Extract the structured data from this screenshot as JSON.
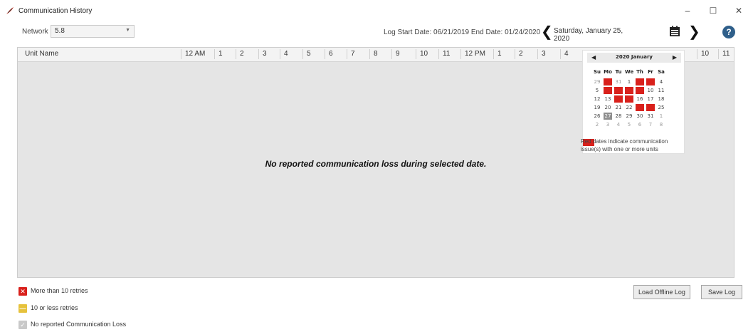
{
  "window": {
    "title": "Communication History",
    "minimize_glyph": "–",
    "maximize_glyph": "☐",
    "close_glyph": "✕",
    "icon": "app-feather-icon"
  },
  "toolbar": {
    "network_label": "Network",
    "network_value": "5.8",
    "log_range_text": "Log Start Date: 06/21/2019  End Date: 01/24/2020",
    "prev_glyph": "❮",
    "next_glyph": "❯",
    "selected_date": "Saturday, January 25, 2020",
    "help_glyph": "?"
  },
  "grid": {
    "unit_column": "Unit Name",
    "hours": [
      "12 AM",
      "1",
      "2",
      "3",
      "4",
      "5",
      "6",
      "7",
      "8",
      "9",
      "10",
      "11",
      "12 PM",
      "1",
      "2",
      "3",
      "4",
      "",
      "",
      "",
      "",
      "",
      "10",
      "11"
    ],
    "empty_message": "No reported communication loss during selected date."
  },
  "calendar": {
    "month_title": "2020 January",
    "prev_glyph": "◀",
    "next_glyph": "▶",
    "weekdays": [
      "Su",
      "Mo",
      "Tu",
      "We",
      "Th",
      "Fr",
      "Sa"
    ],
    "weeks": [
      [
        {
          "d": "29",
          "t": "other"
        },
        {
          "d": "30",
          "t": "red"
        },
        {
          "d": "31",
          "t": "other"
        },
        {
          "d": "1",
          "t": ""
        },
        {
          "d": "2",
          "t": "red"
        },
        {
          "d": "3",
          "t": "red"
        },
        {
          "d": "4",
          "t": ""
        }
      ],
      [
        {
          "d": "5",
          "t": ""
        },
        {
          "d": "6",
          "t": "red"
        },
        {
          "d": "7",
          "t": "red"
        },
        {
          "d": "8",
          "t": "red"
        },
        {
          "d": "9",
          "t": "red"
        },
        {
          "d": "10",
          "t": ""
        },
        {
          "d": "11",
          "t": ""
        }
      ],
      [
        {
          "d": "12",
          "t": ""
        },
        {
          "d": "13",
          "t": ""
        },
        {
          "d": "14",
          "t": "red"
        },
        {
          "d": "15",
          "t": "red"
        },
        {
          "d": "16",
          "t": ""
        },
        {
          "d": "17",
          "t": ""
        },
        {
          "d": "18",
          "t": ""
        }
      ],
      [
        {
          "d": "19",
          "t": ""
        },
        {
          "d": "20",
          "t": ""
        },
        {
          "d": "21",
          "t": ""
        },
        {
          "d": "22",
          "t": ""
        },
        {
          "d": "23",
          "t": "red"
        },
        {
          "d": "24",
          "t": "red"
        },
        {
          "d": "25",
          "t": ""
        }
      ],
      [
        {
          "d": "26",
          "t": ""
        },
        {
          "d": "27",
          "t": "sel"
        },
        {
          "d": "28",
          "t": ""
        },
        {
          "d": "29",
          "t": ""
        },
        {
          "d": "30",
          "t": ""
        },
        {
          "d": "31",
          "t": ""
        },
        {
          "d": "1",
          "t": "other"
        }
      ],
      [
        {
          "d": "2",
          "t": "other"
        },
        {
          "d": "3",
          "t": "other"
        },
        {
          "d": "4",
          "t": "other"
        },
        {
          "d": "5",
          "t": "other"
        },
        {
          "d": "6",
          "t": "other"
        },
        {
          "d": "7",
          "t": "other"
        },
        {
          "d": "8",
          "t": "other"
        }
      ]
    ],
    "legend_text": "Red dates indicate communication issue(s) with one or more units"
  },
  "legend": [
    {
      "text": "More than 10 retries",
      "color": "#d9211c",
      "glyph": "✕",
      "icon": "red-x-icon"
    },
    {
      "text": "10 or less retries",
      "color": "#e6c23c",
      "glyph": "—",
      "icon": "yellow-dash-icon"
    },
    {
      "text": "No reported Communication Loss",
      "color": "#c9c9c9",
      "glyph": "✓",
      "icon": "gray-check-icon"
    }
  ],
  "buttons": {
    "load_offline": "Load Offline Log",
    "save_log": "Save Log"
  },
  "colors": {
    "error_red": "#d9211c",
    "help_blue": "#2f5f8a",
    "grid_bg": "#e5e5e5"
  }
}
